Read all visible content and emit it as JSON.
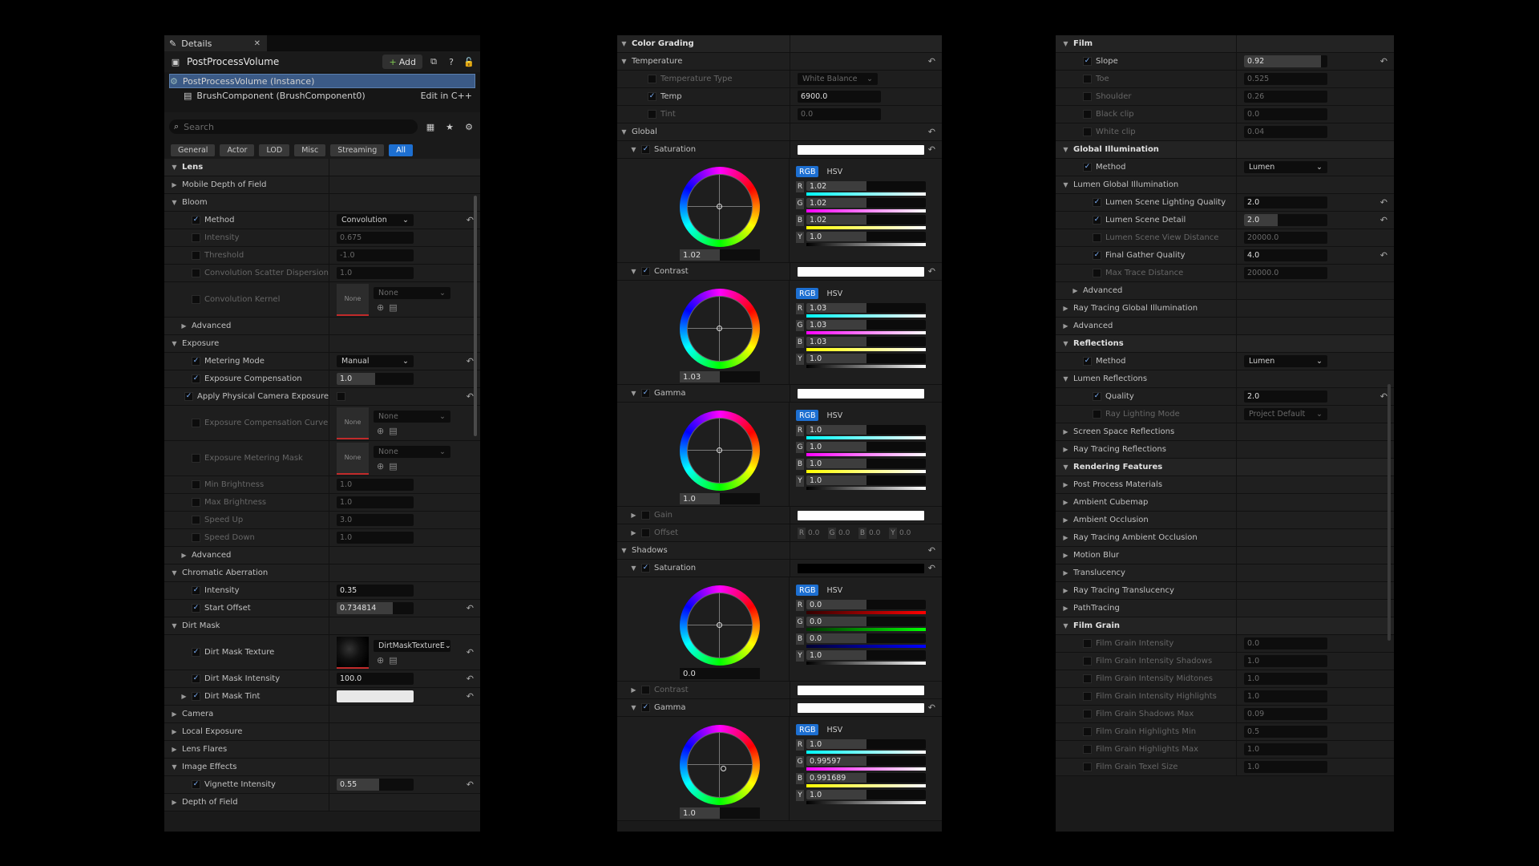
{
  "p1": {
    "tab": "Details",
    "header_title": "PostProcessVolume",
    "add_label": "Add",
    "tree": [
      {
        "label": "PostProcessVolume (Instance)"
      },
      {
        "label": "BrushComponent (BrushComponent0)",
        "link": "Edit in C++"
      }
    ],
    "search_placeholder": "Search",
    "filters": [
      "General",
      "Actor",
      "LOD",
      "Misc",
      "Streaming",
      "All"
    ],
    "rows": [
      {
        "t": "cat",
        "ind": 0,
        "arrow": "down",
        "name": "Lens"
      },
      {
        "t": "sub",
        "ind": 0,
        "arrow": "right",
        "name": "Mobile Depth of Field"
      },
      {
        "t": "sub",
        "ind": 0,
        "arrow": "down",
        "name": "Bloom"
      },
      {
        "ind": 1,
        "check": true,
        "name": "Method",
        "ctrl": "drop",
        "value": "Convolution",
        "reset": true
      },
      {
        "ind": 1,
        "check": false,
        "dim": true,
        "name": "Intensity",
        "ctrl": "num",
        "value": "0.675",
        "fill": 0
      },
      {
        "ind": 1,
        "check": false,
        "dim": true,
        "name": "Threshold",
        "ctrl": "num",
        "value": "-1.0",
        "fill": 0
      },
      {
        "ind": 1,
        "check": false,
        "dim": true,
        "name": "Convolution Scatter Dispersion",
        "ctrl": "num",
        "value": "1.0",
        "fill": 0
      },
      {
        "ind": 1,
        "check": false,
        "dim": true,
        "name": "Convolution Kernel",
        "ctrl": "asset",
        "thumb": "None",
        "value": "None",
        "h": 44
      },
      {
        "t": "sub",
        "ind": 1,
        "arrow": "right",
        "name": "Advanced"
      },
      {
        "t": "sub",
        "ind": 0,
        "arrow": "down",
        "name": "Exposure"
      },
      {
        "ind": 1,
        "check": true,
        "name": "Metering Mode",
        "ctrl": "drop",
        "value": "Manual",
        "reset": true
      },
      {
        "ind": 1,
        "check": true,
        "name": "Exposure Compensation",
        "ctrl": "num",
        "value": "1.0",
        "fill": 0.5
      },
      {
        "ind": 1,
        "check": true,
        "name": "Apply Physical Camera Exposure",
        "ctrl": "cb",
        "reset": true
      },
      {
        "ind": 1,
        "check": false,
        "dim": true,
        "name": "Exposure Compensation Curve",
        "ctrl": "asset",
        "thumb": "None",
        "value": "None",
        "h": 44
      },
      {
        "ind": 1,
        "check": false,
        "dim": true,
        "name": "Exposure Metering Mask",
        "ctrl": "asset",
        "thumb": "None",
        "value": "None",
        "h": 44
      },
      {
        "ind": 1,
        "check": false,
        "dim": true,
        "name": "Min Brightness",
        "ctrl": "num",
        "value": "1.0",
        "fill": 0
      },
      {
        "ind": 1,
        "check": false,
        "dim": true,
        "name": "Max Brightness",
        "ctrl": "num",
        "value": "1.0",
        "fill": 0
      },
      {
        "ind": 1,
        "check": false,
        "dim": true,
        "name": "Speed Up",
        "ctrl": "num",
        "value": "3.0",
        "fill": 0
      },
      {
        "ind": 1,
        "check": false,
        "dim": true,
        "name": "Speed Down",
        "ctrl": "num",
        "value": "1.0",
        "fill": 0
      },
      {
        "t": "sub",
        "ind": 1,
        "arrow": "right",
        "name": "Advanced"
      },
      {
        "t": "sub",
        "ind": 0,
        "arrow": "down",
        "name": "Chromatic Aberration"
      },
      {
        "ind": 1,
        "check": true,
        "name": "Intensity",
        "ctrl": "num",
        "value": "0.35",
        "fill": 0
      },
      {
        "ind": 1,
        "check": true,
        "name": "Start Offset",
        "ctrl": "num",
        "value": "0.734814",
        "fill": 0.73,
        "reset": true
      },
      {
        "t": "sub",
        "ind": 0,
        "arrow": "down",
        "name": "Dirt Mask"
      },
      {
        "ind": 1,
        "check": true,
        "name": "Dirt Mask Texture",
        "ctrl": "asset",
        "thumb": "",
        "dirt": true,
        "value": "DirtMaskTextureE",
        "h": 44,
        "reset": true
      },
      {
        "ind": 1,
        "check": true,
        "name": "Dirt Mask Intensity",
        "ctrl": "num",
        "value": "100.0",
        "fill": 0,
        "reset": true
      },
      {
        "ind": 1,
        "arrow": "right",
        "check": true,
        "name": "Dirt Mask Tint",
        "ctrl": "swatch",
        "reset": true
      },
      {
        "t": "sub",
        "ind": 0,
        "arrow": "right",
        "name": "Camera"
      },
      {
        "t": "sub",
        "ind": 0,
        "arrow": "right",
        "name": "Local Exposure"
      },
      {
        "t": "sub",
        "ind": 0,
        "arrow": "right",
        "name": "Lens Flares"
      },
      {
        "t": "sub",
        "ind": 0,
        "arrow": "down",
        "name": "Image Effects"
      },
      {
        "ind": 1,
        "check": true,
        "name": "Vignette Intensity",
        "ctrl": "num",
        "value": "0.55",
        "fill": 0.55,
        "reset": true
      },
      {
        "t": "sub",
        "ind": 0,
        "arrow": "right",
        "name": "Depth of Field"
      }
    ]
  },
  "p2": {
    "blocks": [
      {
        "k": "cat",
        "name": "Color Grading"
      },
      {
        "k": "sub",
        "name": "Temperature",
        "reset": true
      },
      {
        "k": "row",
        "check": false,
        "dim": true,
        "name": "Temperature Type",
        "ctrl": "drop",
        "value": "White Balance"
      },
      {
        "k": "row",
        "check": true,
        "name": "Temp",
        "ctrl": "num",
        "value": "6900.0",
        "fill": 0
      },
      {
        "k": "row",
        "check": false,
        "dim": true,
        "name": "Tint",
        "ctrl": "num",
        "value": "0.0",
        "fill": 0
      },
      {
        "k": "sub",
        "name": "Global",
        "reset": true
      },
      {
        "k": "prop",
        "check": true,
        "name": "Saturation",
        "bar": "#ffffff",
        "reset": true
      },
      {
        "k": "wheel",
        "value": "1.02",
        "fill": 0.5,
        "dot": [
          0,
          0
        ],
        "ch": [
          {
            "l": "R",
            "v": "1.02",
            "g": "linear-gradient(90deg,#0ff,#fff)"
          },
          {
            "l": "G",
            "v": "1.02",
            "g": "linear-gradient(90deg,#f0f,#fff)"
          },
          {
            "l": "B",
            "v": "1.02",
            "g": "linear-gradient(90deg,#ff0,#fff)"
          },
          {
            "l": "Y",
            "v": "1.0",
            "g": "linear-gradient(90deg,#000,#fff)"
          }
        ]
      },
      {
        "k": "prop",
        "check": true,
        "name": "Contrast",
        "bar": "#ffffff",
        "reset": true
      },
      {
        "k": "wheel",
        "value": "1.03",
        "fill": 0.5,
        "dot": [
          0,
          0
        ],
        "ch": [
          {
            "l": "R",
            "v": "1.03",
            "g": "linear-gradient(90deg,#0ff,#fff)"
          },
          {
            "l": "G",
            "v": "1.03",
            "g": "linear-gradient(90deg,#f0f,#fff)"
          },
          {
            "l": "B",
            "v": "1.03",
            "g": "linear-gradient(90deg,#ff0,#fff)"
          },
          {
            "l": "Y",
            "v": "1.0",
            "g": "linear-gradient(90deg,#000,#fff)"
          }
        ]
      },
      {
        "k": "prop",
        "check": true,
        "name": "Gamma",
        "bar": "#ffffff"
      },
      {
        "k": "wheel",
        "value": "1.0",
        "fill": 0.5,
        "dot": [
          0,
          0
        ],
        "ch": [
          {
            "l": "R",
            "v": "1.0",
            "g": "linear-gradient(90deg,#0ff,#fff)"
          },
          {
            "l": "G",
            "v": "1.0",
            "g": "linear-gradient(90deg,#f0f,#fff)"
          },
          {
            "l": "B",
            "v": "1.0",
            "g": "linear-gradient(90deg,#ff0,#fff)"
          },
          {
            "l": "Y",
            "v": "1.0",
            "g": "linear-gradient(90deg,#000,#fff)"
          }
        ]
      },
      {
        "k": "prop",
        "arrow": "right",
        "check": false,
        "dim": true,
        "name": "Gain",
        "bar": "#ffffff"
      },
      {
        "k": "offset",
        "name": "Offset",
        "vals": [
          [
            "R",
            "0.0"
          ],
          [
            "G",
            "0.0"
          ],
          [
            "B",
            "0.0"
          ],
          [
            "Y",
            "0.0"
          ]
        ]
      },
      {
        "k": "sub",
        "name": "Shadows",
        "reset": true
      },
      {
        "k": "prop",
        "check": true,
        "name": "Saturation",
        "bar": "#000000",
        "reset": true
      },
      {
        "k": "wheel",
        "value": "0.0",
        "fill": 0,
        "dot": [
          0,
          0
        ],
        "ch": [
          {
            "l": "R",
            "v": "0.0",
            "g": "linear-gradient(90deg,#300,#f00)"
          },
          {
            "l": "G",
            "v": "0.0",
            "g": "linear-gradient(90deg,#030,#0f0)"
          },
          {
            "l": "B",
            "v": "0.0",
            "g": "linear-gradient(90deg,#003,#00f)"
          },
          {
            "l": "Y",
            "v": "1.0",
            "g": "linear-gradient(90deg,#000,#fff)"
          }
        ]
      },
      {
        "k": "prop",
        "arrow": "right",
        "check": false,
        "dim": true,
        "name": "Contrast",
        "bar": "#ffffff"
      },
      {
        "k": "prop",
        "check": true,
        "name": "Gamma",
        "bar": "#ffffff",
        "reset": true
      },
      {
        "k": "wheel",
        "value": "1.0",
        "fill": 0.5,
        "dot": [
          0.06,
          0.06
        ],
        "ch": [
          {
            "l": "R",
            "v": "1.0",
            "g": "linear-gradient(90deg,#0ff,#fff)"
          },
          {
            "l": "G",
            "v": "0.99597",
            "g": "linear-gradient(90deg,#f0f,#fff)"
          },
          {
            "l": "B",
            "v": "0.991689",
            "g": "linear-gradient(90deg,#ff0,#fff)"
          },
          {
            "l": "Y",
            "v": "1.0",
            "g": "linear-gradient(90deg,#000,#fff)"
          }
        ]
      }
    ],
    "rgb": "RGB",
    "hsv": "HSV"
  },
  "p3": {
    "rows": [
      {
        "t": "cat",
        "arrow": "down",
        "name": "Film"
      },
      {
        "ind": 1,
        "check": true,
        "name": "Slope",
        "ctrl": "num",
        "value": "0.92",
        "fill": 0.92,
        "reset": true
      },
      {
        "ind": 1,
        "check": false,
        "dim": true,
        "name": "Toe",
        "ctrl": "num",
        "value": "0.525",
        "fill": 0
      },
      {
        "ind": 1,
        "check": false,
        "dim": true,
        "name": "Shoulder",
        "ctrl": "num",
        "value": "0.26",
        "fill": 0
      },
      {
        "ind": 1,
        "check": false,
        "dim": true,
        "name": "Black clip",
        "ctrl": "num",
        "value": "0.0",
        "fill": 0
      },
      {
        "ind": 1,
        "check": false,
        "dim": true,
        "name": "White clip",
        "ctrl": "num",
        "value": "0.04",
        "fill": 0
      },
      {
        "t": "cat",
        "arrow": "down",
        "name": "Global Illumination"
      },
      {
        "ind": 1,
        "check": true,
        "name": "Method",
        "ctrl": "drop",
        "value": "Lumen"
      },
      {
        "t": "sub",
        "arrow": "down",
        "name": "Lumen Global Illumination"
      },
      {
        "ind": 2,
        "check": true,
        "name": "Lumen Scene Lighting Quality",
        "ctrl": "num",
        "value": "2.0",
        "fill": 0,
        "reset": true
      },
      {
        "ind": 2,
        "check": true,
        "name": "Lumen Scene Detail",
        "ctrl": "num",
        "value": "2.0",
        "fill": 0.4,
        "reset": true
      },
      {
        "ind": 2,
        "check": false,
        "dim": true,
        "name": "Lumen Scene View Distance",
        "ctrl": "num",
        "value": "20000.0",
        "fill": 0
      },
      {
        "ind": 2,
        "check": true,
        "name": "Final Gather Quality",
        "ctrl": "num",
        "value": "4.0",
        "fill": 0,
        "reset": true
      },
      {
        "ind": 2,
        "check": false,
        "dim": true,
        "name": "Max Trace Distance",
        "ctrl": "num",
        "value": "20000.0",
        "fill": 0
      },
      {
        "t": "sub",
        "ind": 1,
        "arrow": "right",
        "name": "Advanced"
      },
      {
        "t": "sub",
        "arrow": "right",
        "name": "Ray Tracing Global Illumination"
      },
      {
        "t": "sub",
        "arrow": "right",
        "name": "Advanced"
      },
      {
        "t": "cat",
        "arrow": "down",
        "name": "Reflections"
      },
      {
        "ind": 1,
        "check": true,
        "name": "Method",
        "ctrl": "drop",
        "value": "Lumen"
      },
      {
        "t": "sub",
        "arrow": "down",
        "name": "Lumen Reflections"
      },
      {
        "ind": 2,
        "check": true,
        "name": "Quality",
        "ctrl": "num",
        "value": "2.0",
        "fill": 0,
        "reset": true
      },
      {
        "ind": 2,
        "check": false,
        "dim": true,
        "name": "Ray Lighting Mode",
        "ctrl": "drop",
        "value": "Project Default"
      },
      {
        "t": "sub",
        "arrow": "right",
        "name": "Screen Space Reflections"
      },
      {
        "t": "sub",
        "arrow": "right",
        "name": "Ray Tracing Reflections"
      },
      {
        "t": "cat",
        "arrow": "down",
        "name": "Rendering Features"
      },
      {
        "t": "sub",
        "arrow": "right",
        "name": "Post Process Materials"
      },
      {
        "t": "sub",
        "arrow": "right",
        "name": "Ambient Cubemap"
      },
      {
        "t": "sub",
        "arrow": "right",
        "name": "Ambient Occlusion"
      },
      {
        "t": "sub",
        "arrow": "right",
        "name": "Ray Tracing Ambient Occlusion"
      },
      {
        "t": "sub",
        "arrow": "right",
        "name": "Motion Blur"
      },
      {
        "t": "sub",
        "arrow": "right",
        "name": "Translucency"
      },
      {
        "t": "sub",
        "arrow": "right",
        "name": "Ray Tracing Translucency"
      },
      {
        "t": "sub",
        "arrow": "right",
        "name": "PathTracing"
      },
      {
        "t": "cat",
        "arrow": "down",
        "name": "Film Grain"
      },
      {
        "ind": 1,
        "check": false,
        "dim": true,
        "name": "Film Grain Intensity",
        "ctrl": "num",
        "value": "0.0",
        "fill": 0
      },
      {
        "ind": 1,
        "check": false,
        "dim": true,
        "name": "Film Grain Intensity Shadows",
        "ctrl": "num",
        "value": "1.0",
        "fill": 0
      },
      {
        "ind": 1,
        "check": false,
        "dim": true,
        "name": "Film Grain Intensity Midtones",
        "ctrl": "num",
        "value": "1.0",
        "fill": 0
      },
      {
        "ind": 1,
        "check": false,
        "dim": true,
        "name": "Film Grain Intensity Highlights",
        "ctrl": "num",
        "value": "1.0",
        "fill": 0
      },
      {
        "ind": 1,
        "check": false,
        "dim": true,
        "name": "Film Grain Shadows Max",
        "ctrl": "num",
        "value": "0.09",
        "fill": 0
      },
      {
        "ind": 1,
        "check": false,
        "dim": true,
        "name": "Film Grain Highlights Min",
        "ctrl": "num",
        "value": "0.5",
        "fill": 0
      },
      {
        "ind": 1,
        "check": false,
        "dim": true,
        "name": "Film Grain Highlights Max",
        "ctrl": "num",
        "value": "1.0",
        "fill": 0
      },
      {
        "ind": 1,
        "check": false,
        "dim": true,
        "name": "Film Grain Texel Size",
        "ctrl": "num",
        "value": "1.0",
        "fill": 0
      }
    ]
  }
}
